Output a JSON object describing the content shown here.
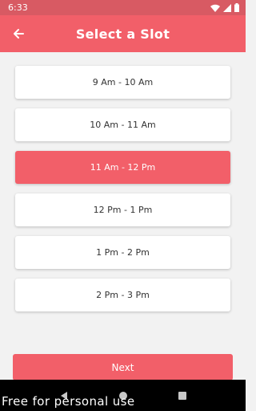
{
  "status_bar": {
    "time": "6:33"
  },
  "app_bar": {
    "title": "Select a Slot"
  },
  "slots": [
    {
      "label": "9 Am - 10 Am",
      "selected": false
    },
    {
      "label": "10 Am - 11 Am",
      "selected": false
    },
    {
      "label": "11 Am - 12 Pm",
      "selected": true
    },
    {
      "label": "12 Pm - 1 Pm",
      "selected": false
    },
    {
      "label": "1 Pm - 2 Pm",
      "selected": false
    },
    {
      "label": "2 Pm - 3 Pm",
      "selected": false
    }
  ],
  "footer": {
    "next_label": "Next"
  },
  "watermark": "Free for personal use",
  "colors": {
    "accent": "#f25f69",
    "status_bar": "#d85a63",
    "background": "#f2f2f2"
  },
  "icons": [
    "wifi-icon",
    "signal-icon",
    "battery-icon",
    "back-arrow-icon",
    "nav-back-icon",
    "nav-home-icon",
    "nav-recents-icon"
  ]
}
